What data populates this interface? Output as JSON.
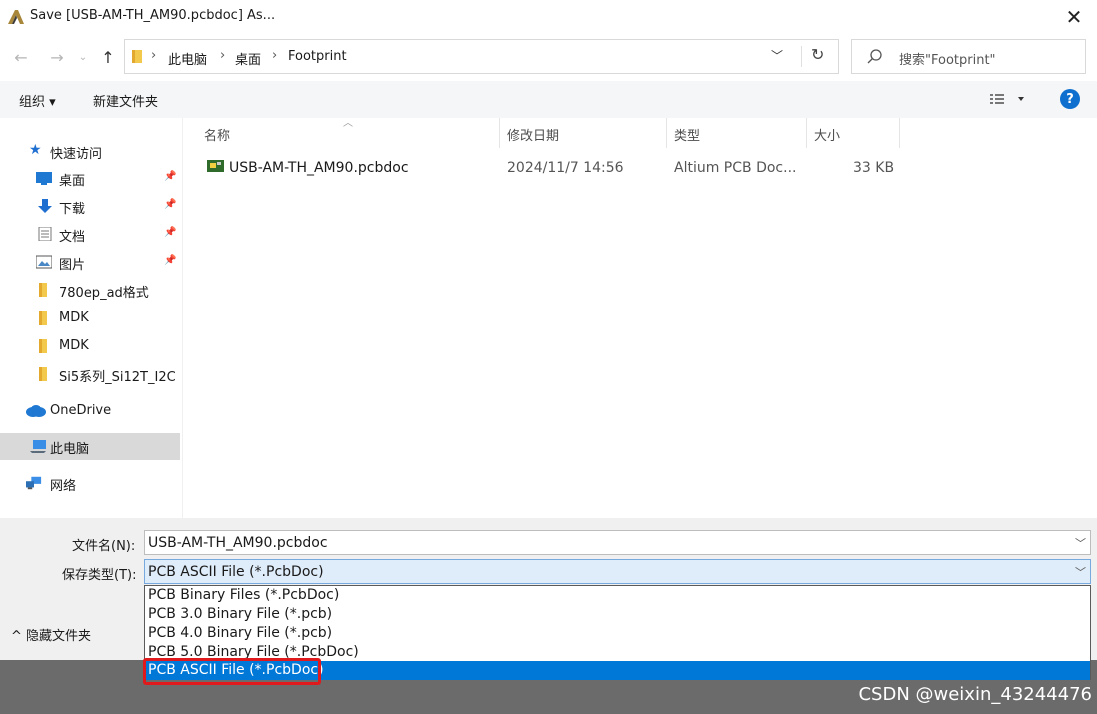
{
  "title": "Save [USB-AM-TH_AM90.pcbdoc] As...",
  "address": {
    "crumbs": [
      "此电脑",
      "桌面",
      "Footprint"
    ],
    "search_placeholder": "搜索\"Footprint\""
  },
  "toolbar": {
    "organize": "组织 ▾",
    "new_folder": "新建文件夹"
  },
  "nav": {
    "quick_access": "快速访问",
    "items": [
      "桌面",
      "下载",
      "文档",
      "图片",
      "780ep_ad格式",
      "MDK",
      "MDK",
      "Si5系列_Si12T_I2C"
    ],
    "onedrive": "OneDrive",
    "this_pc": "此电脑",
    "network": "网络"
  },
  "columns": {
    "name": "名称",
    "date": "修改日期",
    "type": "类型",
    "size": "大小"
  },
  "files": [
    {
      "name": "USB-AM-TH_AM90.pcbdoc",
      "date": "2024/11/7 14:56",
      "type": "Altium PCB Doc...",
      "size": "33 KB"
    }
  ],
  "form": {
    "filename_label": "文件名(N):",
    "filename_value": "USB-AM-TH_AM90.pcbdoc",
    "type_label": "保存类型(T):",
    "type_value": "PCB ASCII File (*.PcbDoc)",
    "hide_folders": "隐藏文件夹"
  },
  "type_options": [
    "PCB Binary Files (*.PcbDoc)",
    "PCB 3.0 Binary File (*.pcb)",
    "PCB 4.0 Binary File (*.pcb)",
    "PCB 5.0 Binary File (*.PcbDoc)",
    "PCB ASCII File (*.PcbDoc)"
  ],
  "selected_option_index": 4,
  "watermark": "CSDN @weixin_43244476",
  "colors": {
    "accent": "#0078d7",
    "highlight_box": "#e0191c",
    "folder": "#f2c94c",
    "help": "#0e6fce"
  }
}
